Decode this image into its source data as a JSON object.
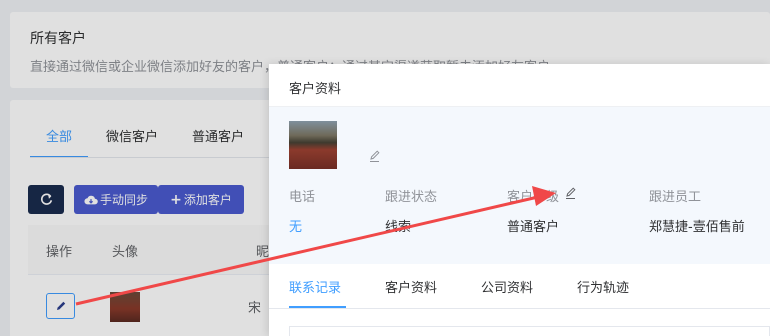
{
  "background": {
    "card_title": "所有客户",
    "card_desc": "直接通过微信或企业微信添加好友的客户，普通客户：通过其它渠道获取暂未添加好友客户",
    "tabs": [
      {
        "label": "全部",
        "active": true
      },
      {
        "label": "微信客户",
        "active": false
      },
      {
        "label": "普通客户",
        "active": false
      }
    ],
    "buttons": {
      "refresh_icon": "refresh-icon",
      "sync_label": "手动同步",
      "add_label": "添加客户"
    },
    "table_headers": [
      "操作",
      "头像",
      "昵"
    ],
    "row": {
      "name": "宋"
    }
  },
  "drawer": {
    "title": "客户资料",
    "fields": [
      {
        "label": "电话",
        "value": "无"
      },
      {
        "label": "跟进状态",
        "value": "线索"
      },
      {
        "label": "客户等级",
        "value": "普通客户"
      },
      {
        "label": "跟进员工",
        "value": "郑慧捷-壹佰售前"
      }
    ],
    "tabs": [
      {
        "label": "联系记录",
        "active": true
      },
      {
        "label": "客户资料",
        "active": false
      },
      {
        "label": "公司资料",
        "active": false
      },
      {
        "label": "行为轨迹",
        "active": false
      }
    ]
  },
  "colors": {
    "accent": "#409eff",
    "button_dark": "#1a2c4e",
    "button_primary": "#4a5bd0",
    "annotation_arrow": "#f04848"
  }
}
